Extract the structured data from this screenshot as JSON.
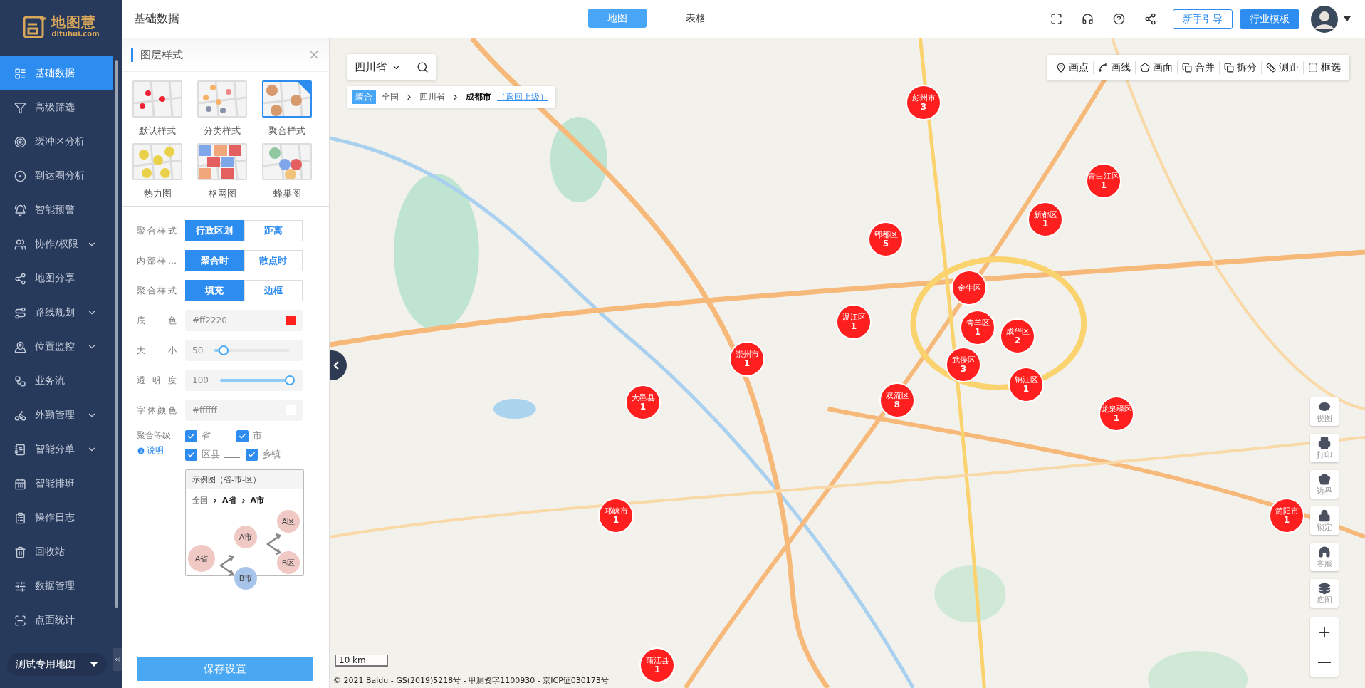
{
  "app": {
    "logo_name": "地图慧",
    "logo_domain": "dituhui.com"
  },
  "sidebar": {
    "items": [
      {
        "label": "基础数据",
        "selected": true,
        "has_submenu": false
      },
      {
        "label": "高级筛选",
        "selected": false,
        "has_submenu": false
      },
      {
        "label": "缓冲区分析",
        "selected": false,
        "has_submenu": false
      },
      {
        "label": "到达圈分析",
        "selected": false,
        "has_submenu": false
      },
      {
        "label": "智能预警",
        "selected": false,
        "has_submenu": false
      },
      {
        "label": "协作/权限",
        "selected": false,
        "has_submenu": true
      },
      {
        "label": "地图分享",
        "selected": false,
        "has_submenu": false
      },
      {
        "label": "路线规划",
        "selected": false,
        "has_submenu": true
      },
      {
        "label": "位置监控",
        "selected": false,
        "has_submenu": true
      },
      {
        "label": "业务流",
        "selected": false,
        "has_submenu": false
      },
      {
        "label": "外勤管理",
        "selected": false,
        "has_submenu": true
      },
      {
        "label": "智能分单",
        "selected": false,
        "has_submenu": true
      },
      {
        "label": "智能排班",
        "selected": false,
        "has_submenu": false
      },
      {
        "label": "操作日志",
        "selected": false,
        "has_submenu": false
      },
      {
        "label": "回收站",
        "selected": false,
        "has_submenu": false
      },
      {
        "label": "数据管理",
        "selected": false,
        "has_submenu": false
      },
      {
        "label": "点面统计",
        "selected": false,
        "has_submenu": false
      }
    ],
    "map_selector": "测试专用地图"
  },
  "header": {
    "title": "基础数据",
    "views": [
      {
        "label": "地图",
        "selected": true
      },
      {
        "label": "表格",
        "selected": false
      }
    ],
    "buttons": [
      {
        "label": "新手引导",
        "kind": "outline"
      },
      {
        "label": "行业模板",
        "kind": "primary"
      }
    ]
  },
  "panel": {
    "title": "图层样式",
    "styles": [
      {
        "label": "默认样式",
        "selected": false
      },
      {
        "label": "分类样式",
        "selected": false
      },
      {
        "label": "聚合样式",
        "selected": true
      },
      {
        "label": "热力图",
        "selected": false
      },
      {
        "label": "格网图",
        "selected": false
      },
      {
        "label": "蜂巢图",
        "selected": false
      }
    ],
    "settings": [
      {
        "kind": "toggle",
        "label": "聚合样式",
        "options": [
          {
            "label": "行政区划",
            "selected": true
          },
          {
            "label": "距离",
            "selected": false
          }
        ]
      },
      {
        "kind": "toggle",
        "label": "内部样…",
        "options": [
          {
            "label": "聚合时",
            "selected": true
          },
          {
            "label": "散点时",
            "selected": false
          }
        ]
      },
      {
        "kind": "toggle",
        "label": "聚合样式",
        "options": [
          {
            "label": "填充",
            "selected": true
          },
          {
            "label": "边框",
            "selected": false
          }
        ]
      },
      {
        "kind": "color",
        "label": "底色",
        "value": "#ff2220"
      },
      {
        "kind": "slider",
        "label": "大小",
        "value": "50",
        "level": 0.12
      },
      {
        "kind": "slider",
        "label": "透明度",
        "value": "100",
        "level": 1
      },
      {
        "kind": "color",
        "label": "字体颜色",
        "value": "#ffffff"
      }
    ],
    "levels": {
      "label": "聚合等级",
      "help": "说明",
      "options": [
        {
          "label": "省",
          "checked": true
        },
        {
          "label": "市",
          "checked": true
        },
        {
          "label": "区县",
          "checked": true
        },
        {
          "label": "乡镇",
          "checked": true
        }
      ]
    },
    "example": {
      "title": "示例图（省-市-区）",
      "path": [
        "全国",
        "A省",
        "A市"
      ],
      "nodes": [
        {
          "label": "A省",
          "color": "#f0c8c4"
        },
        {
          "label": "A市",
          "color": "#f0c8c4"
        },
        {
          "label": "B市",
          "color": "#a9c4ea"
        },
        {
          "label": "A区",
          "color": "#f0c8c4"
        },
        {
          "label": "B区",
          "color": "#f0c8c4"
        }
      ]
    },
    "save": "保存设置"
  },
  "map": {
    "region": "四川省",
    "breadcrumb": {
      "tag": "聚合",
      "path": [
        "全国",
        "四川省",
        "成都市"
      ],
      "back": "（返回上级）"
    },
    "tools": [
      "画点",
      "画线",
      "画面",
      "合并",
      "拆分",
      "测距",
      "框选"
    ],
    "side_tools": [
      "视图",
      "打印",
      "边界",
      "锁定",
      "客服",
      "底图"
    ],
    "clusters": [
      {
        "name": "彭州市",
        "count": "3"
      },
      {
        "name": "青白江区",
        "count": "1"
      },
      {
        "name": "新都区",
        "count": "1"
      },
      {
        "name": "郫都区",
        "count": "5"
      },
      {
        "name": "金牛区"
      },
      {
        "name": "青羊区",
        "count": "1"
      },
      {
        "name": "成华区",
        "count": "2"
      },
      {
        "name": "武侯区",
        "count": "3"
      },
      {
        "name": "温江区",
        "count": "1"
      },
      {
        "name": "崇州市",
        "count": "1"
      },
      {
        "name": "锦江区",
        "count": "1"
      },
      {
        "name": "双流区",
        "count": "8"
      },
      {
        "name": "龙泉驿区",
        "count": "1"
      },
      {
        "name": "大邑县",
        "count": "1"
      },
      {
        "name": "邛崃市",
        "count": "1"
      },
      {
        "name": "简阳市",
        "count": "1"
      },
      {
        "name": "蒲江县",
        "count": "1"
      }
    ],
    "scale": "10 km",
    "copyright": "© 2021 Baidu - GS(2019)5218号 - 甲测资字1100930 - 京ICP证030173号"
  }
}
